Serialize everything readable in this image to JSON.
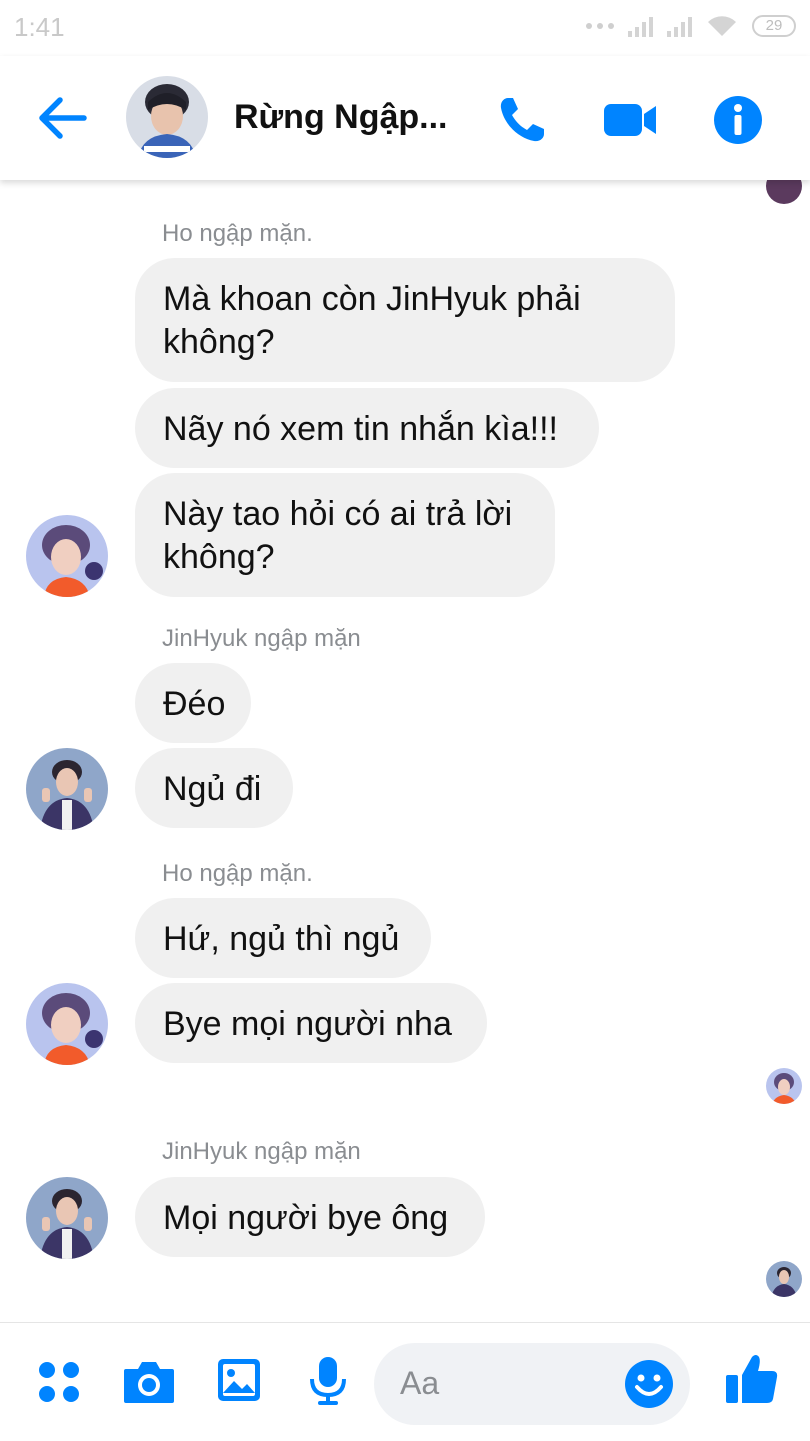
{
  "status_bar": {
    "time": "1:41",
    "battery": "29"
  },
  "header": {
    "title": "Rừng Ngập..."
  },
  "composer": {
    "placeholder": "Aa"
  },
  "colors": {
    "accent": "#0084ff",
    "bubble": "#f0f0f0",
    "sender_label": "#8a8d91"
  },
  "icons": {
    "header": [
      "back-arrow-icon",
      "phone-icon",
      "video-icon",
      "info-icon"
    ],
    "bottom_bar": [
      "apps-icon",
      "camera-icon",
      "gallery-icon",
      "microphone-icon",
      "emoji-icon",
      "like-icon"
    ]
  },
  "messages": [
    {
      "sender": "Ho ngập mặn.",
      "texts": [
        "Mà khoan còn JinHyuk phải\nkhông?",
        "Nãy nó xem tin nhắn kìa!!!",
        "Này tao hỏi có ai trả lời\nkhông?"
      ]
    },
    {
      "sender": "JinHyuk ngập mặn",
      "texts": [
        "Đéo",
        "Ngủ đi"
      ]
    },
    {
      "sender": "Ho ngập mặn.",
      "texts": [
        "Hứ, ngủ thì ngủ",
        "Bye mọi người nha"
      ]
    },
    {
      "sender": "JinHyuk ngập mặn",
      "texts": [
        "Mọi người bye ông"
      ]
    }
  ]
}
